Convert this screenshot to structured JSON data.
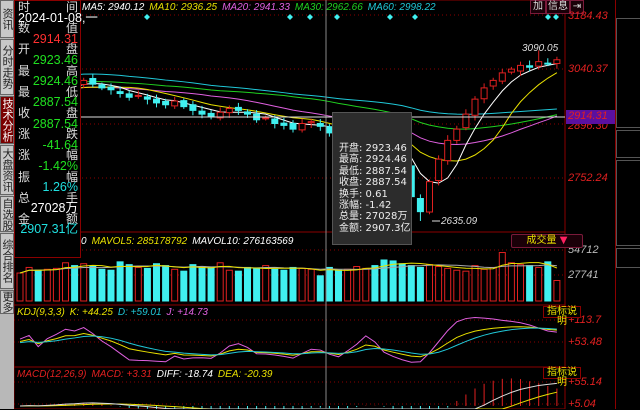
{
  "tabs": [
    {
      "label": "资讯"
    },
    {
      "label": "分时走势"
    },
    {
      "label": "技术分析"
    },
    {
      "label": "大盘资讯"
    },
    {
      "label": "自选股"
    },
    {
      "label": "综合排名"
    },
    {
      "label": "更多"
    }
  ],
  "info": {
    "rows": [
      {
        "l": "时",
        "r": "间"
      },
      {
        "v": "2024-01-08,一",
        "c": "#fff"
      },
      {
        "l": "数",
        "r": "值"
      },
      {
        "v": "2914.31",
        "c": "#ff3030"
      },
      {
        "l": "开",
        "r": "盘"
      },
      {
        "v": "2923.46",
        "c": "#20e020"
      },
      {
        "l": "最",
        "r": "高"
      },
      {
        "v": "2924.46",
        "c": "#20e020"
      },
      {
        "l": "最",
        "r": "低"
      },
      {
        "v": "2887.54",
        "c": "#20e020"
      },
      {
        "l": "收",
        "r": "盘"
      },
      {
        "v": "2887.54",
        "c": "#20e020"
      },
      {
        "l": "涨",
        "r": "跌"
      },
      {
        "v": "-41.64",
        "c": "#20e020"
      },
      {
        "l": "涨",
        "r": "幅"
      },
      {
        "v": "-1.42%",
        "c": "#20e020"
      },
      {
        "l": "振",
        "r": "幅"
      },
      {
        "v": "1.26%",
        "c": "#20e0e0"
      },
      {
        "l": "总",
        "r": "手"
      },
      {
        "v": "27028万",
        "c": "#fff"
      },
      {
        "l": "金",
        "r": "额"
      },
      {
        "v": "2907.31亿",
        "c": "#20e0e0"
      }
    ]
  },
  "ma_header": [
    {
      "t": "MA5: 2940.12",
      "c": "#ffffff"
    },
    {
      "t": "MA10: 2936.25",
      "c": "#e8e000"
    },
    {
      "t": "MA20: 2941.33",
      "c": "#e060e0"
    },
    {
      "t": "MA30: 2962.66",
      "c": "#20d020"
    },
    {
      "t": "MA60: 2998.22",
      "c": "#20c8d8"
    }
  ],
  "top_buttons": {
    "add": "加",
    "info": "信息",
    "expand": "⇥"
  },
  "price_axis": {
    "top": "3184.43",
    "mid": "3040.37",
    "current": "2914.31",
    "hidden": "2896.30",
    "low": "2752.24"
  },
  "annotations": {
    "high": "3090.05",
    "low": "2635.09"
  },
  "tooltip": [
    "开盘: 2923.46",
    "最高: 2924.46",
    "最低: 2887.54",
    "收盘: 2887.54",
    "换手: 0.61",
    "涨幅: -1.42",
    "总量: 27028万",
    "金额: 2907.3亿"
  ],
  "volume": {
    "header": [
      {
        "t": "0",
        "c": "#ffffff"
      },
      {
        "t": "MAVOL5: 285178792",
        "c": "#e8e000"
      },
      {
        "t": "MAVOL10: 276163569",
        "c": "#ffffff"
      }
    ],
    "selector": "成交量",
    "axis": [
      "54712",
      "27741"
    ]
  },
  "kdj": {
    "header": [
      {
        "t": "KDJ(9,3,3)",
        "c": "#e8e000"
      },
      {
        "t": "K: +44.25",
        "c": "#e8e000"
      },
      {
        "t": "D: +59.01",
        "c": "#20c8d8"
      },
      {
        "t": "J: +14.73",
        "c": "#e060e0"
      }
    ],
    "button": "指标说明",
    "axis": [
      "+113.7",
      "+53.48"
    ]
  },
  "macd": {
    "header": [
      {
        "t": "MACD(12,26,9)",
        "c": "#e02020"
      },
      {
        "t": "MACD: +3.31",
        "c": "#e02020"
      },
      {
        "t": "DIFF: -18.74",
        "c": "#ffffff"
      },
      {
        "t": "DEA: -20.39",
        "c": "#e8e000"
      }
    ],
    "button": "指标说明",
    "axis": [
      "+55.14",
      "+5.04"
    ]
  },
  "series": {
    "closes": [
      2975,
      2985,
      2970,
      2990,
      2995,
      3005,
      2998,
      3010,
      3000,
      2990,
      2985,
      2975,
      2965,
      2970,
      2960,
      2950,
      2945,
      2955,
      2940,
      2930,
      2920,
      2915,
      2925,
      2935,
      2930,
      2920,
      2905,
      2910,
      2895,
      2890,
      2880,
      2895,
      2900,
      2887.54,
      2870,
      2860,
      2875,
      2880,
      2890,
      2870,
      2850,
      2820,
      2780,
      2700,
      2660,
      2740,
      2800,
      2850,
      2880,
      2920,
      2960,
      2990,
      3010,
      3030,
      3040,
      3050,
      3045,
      3060,
      3055,
      3065
    ],
    "volumes": [
      30000,
      36000,
      33000,
      34000,
      35000,
      41000,
      38000,
      40000,
      37000,
      34000,
      33000,
      42000,
      39000,
      36000,
      35000,
      40000,
      38000,
      34000,
      32000,
      39000,
      37000,
      36000,
      41000,
      33000,
      32000,
      36000,
      35000,
      38000,
      34000,
      33000,
      36000,
      35000,
      34000,
      27028,
      36000,
      33000,
      34000,
      37000,
      35000,
      38000,
      44000,
      43000,
      40000,
      38000,
      36000,
      39000,
      37000,
      35000,
      33000,
      32000,
      38000,
      34000,
      36000,
      52000,
      41000,
      39000,
      38000,
      36000,
      42000,
      22000
    ]
  },
  "colors": {
    "up": "#e02020",
    "down": "#40f0f0",
    "grid": "#8b0000"
  }
}
